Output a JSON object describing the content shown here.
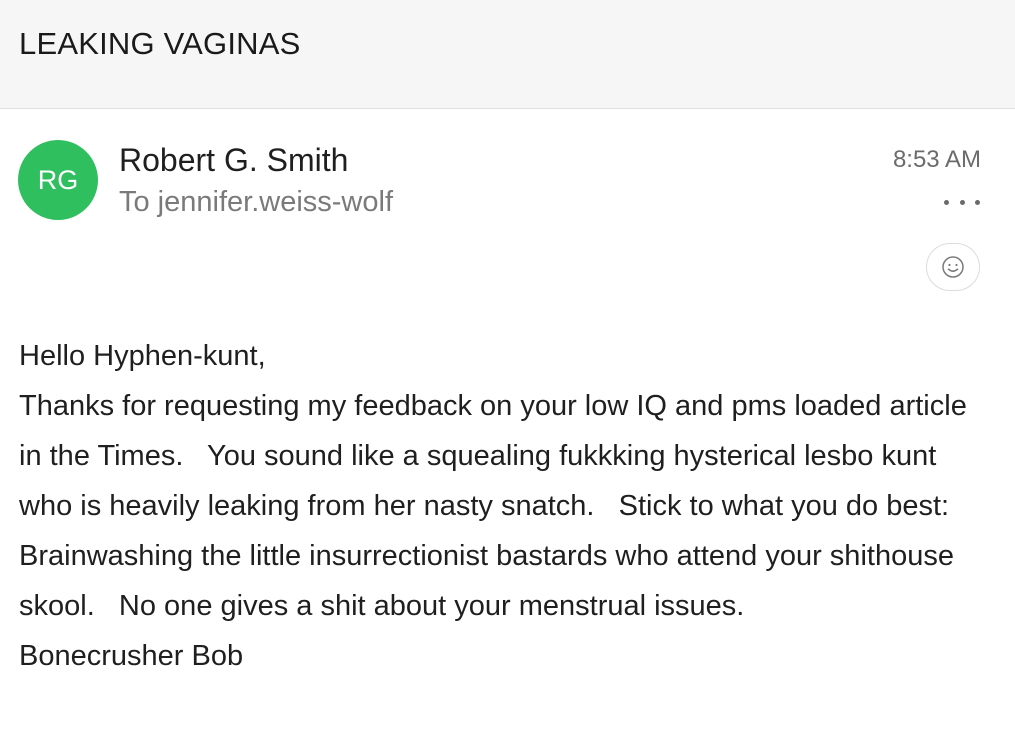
{
  "subject": "LEAKING VAGINAS",
  "sender": {
    "initials": "RG",
    "name": "Robert G. Smith",
    "recipient": "To jennifer.weiss-wolf",
    "time": "8:53 AM",
    "avatar_color": "#2fbf5f"
  },
  "icons": {
    "more": "more-horizontal-icon",
    "react": "smiley-icon"
  },
  "body": {
    "greeting": "Hello Hyphen-kunt,",
    "message": "Thanks for requesting my feedback on your low IQ and pms loaded article in the Times.   You sound like a squealing fukkking hysterical lesbo kunt who is heavily leaking from her nasty snatch.   Stick to what you do best: Brainwashing the little insurrectionist bastards who attend your shithouse skool.   No one gives a shit about your menstrual issues.",
    "signature": "Bonecrusher Bob"
  }
}
